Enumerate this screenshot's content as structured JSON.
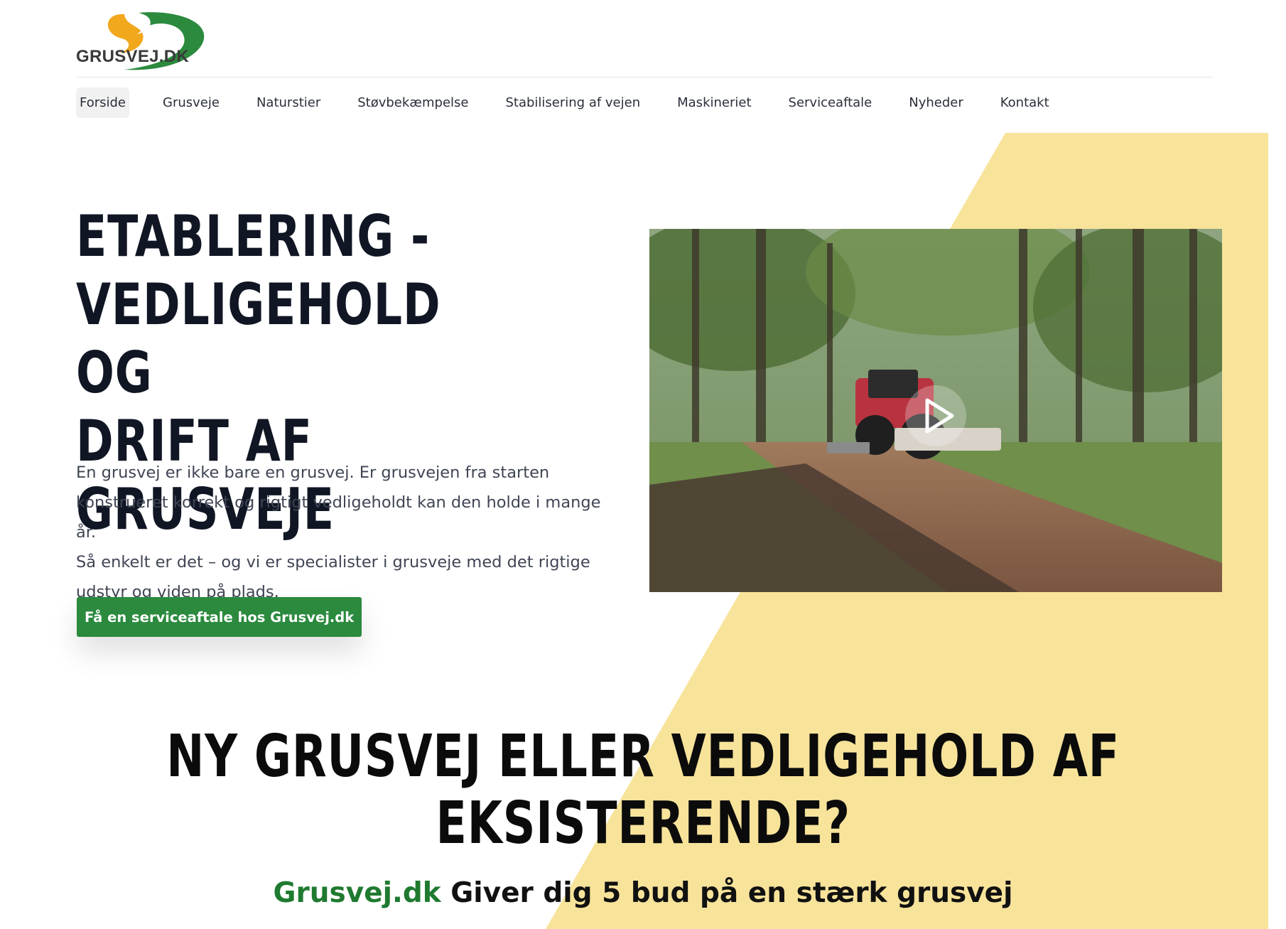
{
  "site": {
    "logo_text": "GRUSVEJ.DK",
    "colors": {
      "brand_green": "#2b8a3e",
      "brand_orange": "#f2a81d",
      "accent_yellow": "#f7e39a",
      "heading": "#111624"
    }
  },
  "nav": {
    "items": [
      {
        "label": "Forside",
        "active": true
      },
      {
        "label": "Grusveje"
      },
      {
        "label": "Naturstier"
      },
      {
        "label": "Støvbekæmpelse"
      },
      {
        "label": "Stabilisering af vejen"
      },
      {
        "label": "Maskineriet"
      },
      {
        "label": "Serviceaftale"
      },
      {
        "label": "Nyheder"
      },
      {
        "label": "Kontakt"
      }
    ]
  },
  "hero": {
    "title_lines": [
      "ETABLERING -",
      "VEDLIGEHOLD OG",
      "DRIFT AF GRUSVEJE"
    ],
    "text_lines": [
      "En grusvej er ikke bare en grusvej. Er grusvejen fra starten",
      "konstrueret korrekt og rigtigt vedligeholdt kan den holde i mange år.",
      "Så enkelt er det – og vi er specialister i grusveje med det rigtige",
      "udstyr og viden på plads."
    ],
    "cta_label": "Få en serviceaftale hos Grusvej.dk",
    "video_icon": "play-icon"
  },
  "section": {
    "title_lines": [
      "NY GRUSVEJ ELLER VEDLIGEHOLD AF",
      "EKSISTERENDE?"
    ],
    "brand": "Grusvej.dk",
    "tagline": " Giver dig 5 bud på en stærk grusvej"
  }
}
